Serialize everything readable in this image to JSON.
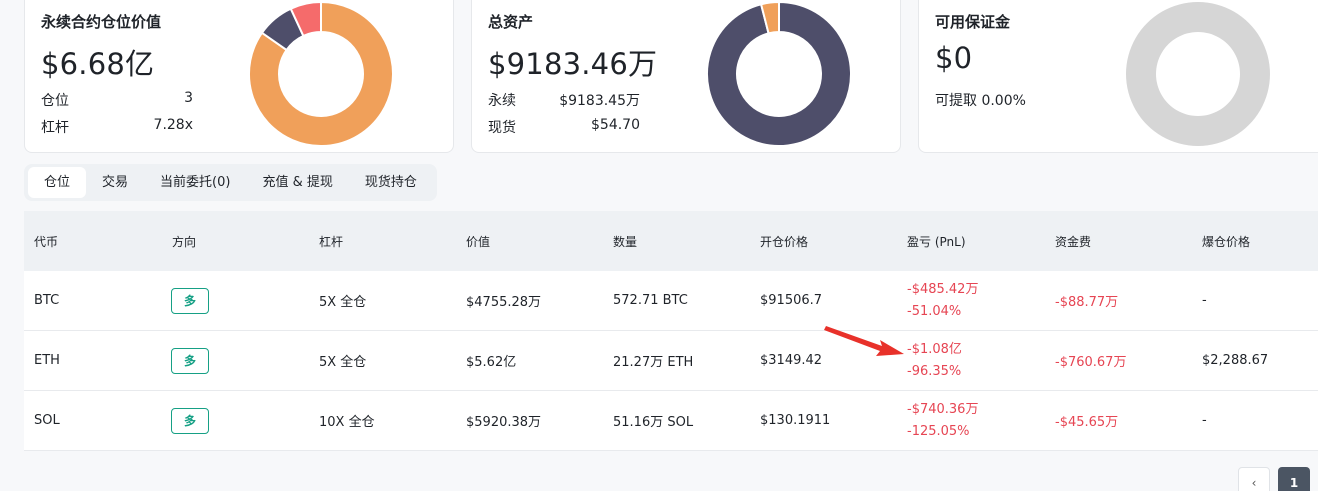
{
  "cards": [
    {
      "title": "永续合约仓位价值",
      "value": "$6.68亿",
      "rows": [
        {
          "label": "仓位",
          "value": "3"
        },
        {
          "label": "杠杆",
          "value": "7.28x"
        }
      ]
    },
    {
      "title": "总资产",
      "value": "$9183.46万",
      "rows": [
        {
          "label": "永续",
          "value": "$9183.45万"
        },
        {
          "label": "现货",
          "value": "$54.70"
        }
      ]
    },
    {
      "title": "可用保证金",
      "value": "$0",
      "rows": [
        {
          "label": "可提取 0.00%",
          "value": ""
        }
      ]
    }
  ],
  "donuts": {
    "positions": {
      "slices": [
        {
          "value": 0.847,
          "color": "#f0a05a"
        },
        {
          "value": 0.084,
          "color": "#4e4e6a"
        },
        {
          "value": 0.069,
          "color": "#f56b6b"
        }
      ]
    },
    "assets": {
      "slices": [
        {
          "value": 0.96,
          "color": "#4e4e6a"
        },
        {
          "value": 0.04,
          "color": "#f0a05a"
        }
      ]
    },
    "margin": {
      "slices": [
        {
          "value": 1.0,
          "color": "#d6d6d6"
        }
      ]
    }
  },
  "tabs": [
    "仓位",
    "交易",
    "当前委托(0)",
    "充值 & 提现",
    "现货持仓"
  ],
  "table": {
    "headers": [
      "代币",
      "方向",
      "杠杆",
      "价值",
      "数量",
      "开仓价格",
      "盈亏 (PnL)",
      "资金费",
      "爆仓价格"
    ],
    "rows": [
      {
        "coin": "BTC",
        "side": "多",
        "lev": "5X 全仓",
        "value": "$4755.28万",
        "qty": "572.71 BTC",
        "entry": "$91506.7",
        "pnl": "-$485.42万",
        "pnl_pct": "-51.04%",
        "funding": "-$88.77万",
        "liq": "-"
      },
      {
        "coin": "ETH",
        "side": "多",
        "lev": "5X 全仓",
        "value": "$5.62亿",
        "qty": "21.27万 ETH",
        "entry": "$3149.42",
        "pnl": "-$1.08亿",
        "pnl_pct": "-96.35%",
        "funding": "-$760.67万",
        "liq": "$2,288.67"
      },
      {
        "coin": "SOL",
        "side": "多",
        "lev": "10X 全仓",
        "value": "$5920.38万",
        "qty": "51.16万 SOL",
        "entry": "$130.1911",
        "pnl": "-$740.36万",
        "pnl_pct": "-125.05%",
        "funding": "-$45.65万",
        "liq": "-"
      }
    ]
  },
  "pager": {
    "prev": "‹",
    "current": "1"
  },
  "colors": {
    "long": "#16a085",
    "negative": "#e64553",
    "annotation": "#e8312a"
  }
}
